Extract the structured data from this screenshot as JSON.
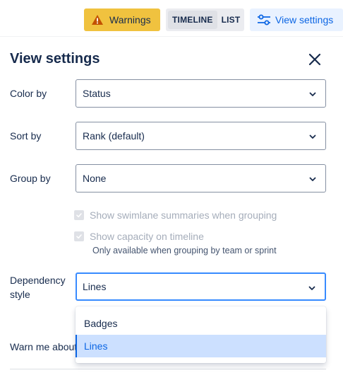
{
  "toolbar": {
    "warnings_label": "Warnings",
    "timeline_label": "TIMELINE",
    "list_label": "LIST",
    "view_settings_label": "View settings"
  },
  "panel": {
    "title": "View settings",
    "color_by": {
      "label": "Color by",
      "value": "Status"
    },
    "sort_by": {
      "label": "Sort by",
      "value": "Rank (default)"
    },
    "group_by": {
      "label": "Group by",
      "value": "None"
    },
    "swimlane_summaries": {
      "label": "Show swimlane summaries when grouping",
      "checked": true,
      "disabled": true
    },
    "show_capacity": {
      "label": "Show capacity on timeline",
      "checked": true,
      "disabled": true
    },
    "capacity_hint": "Only available when grouping by team or sprint",
    "dependency_style": {
      "label_line1": "Dependency",
      "label_line2": "style",
      "value": "Lines",
      "options": [
        "Badges",
        "Lines"
      ],
      "selected_index": 1
    },
    "warn_me_label": "Warn me about"
  },
  "colors": {
    "warning_bg": "#f0c23f",
    "accent": "#0c66e4",
    "selected_option_bg": "#cce0ff",
    "focus_border": "#388bff"
  }
}
